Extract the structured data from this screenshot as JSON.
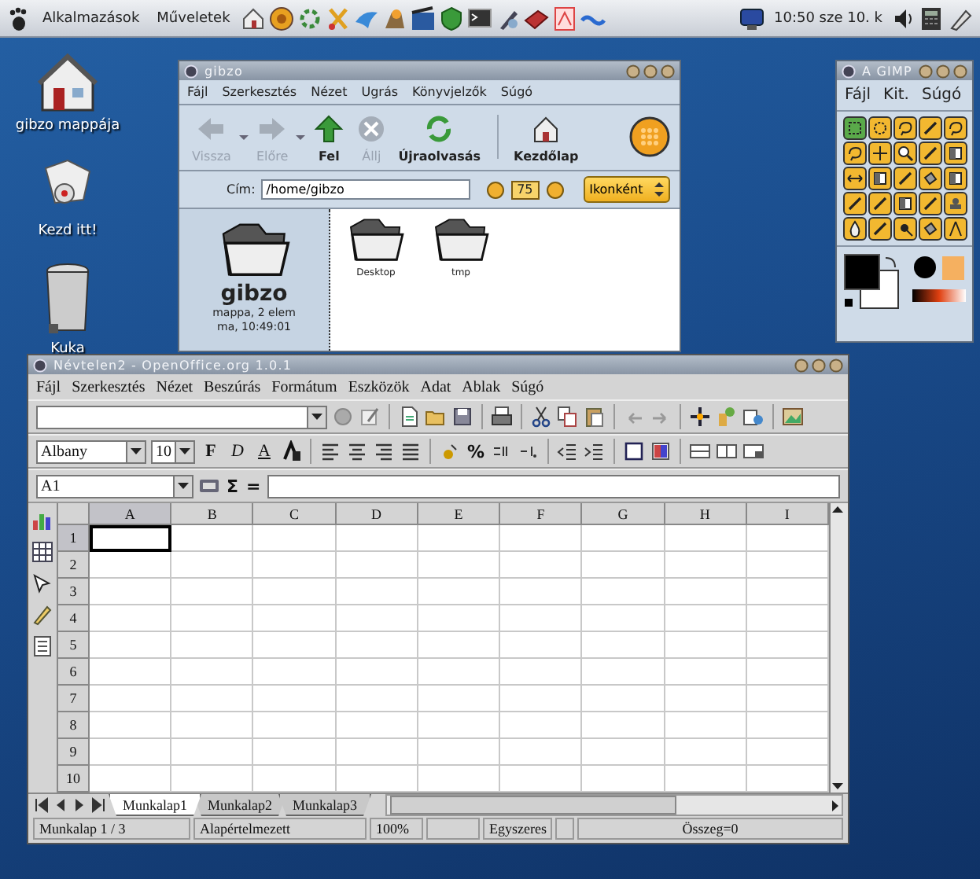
{
  "panel": {
    "menus": [
      "Alkalmazások",
      "Műveletek"
    ],
    "clock": "10:50 sze 10. k"
  },
  "desktop_icons": [
    {
      "label": "gibzo mappája",
      "kind": "home"
    },
    {
      "label": "Kezd itt!",
      "kind": "start"
    },
    {
      "label": "Kuka",
      "kind": "trash"
    }
  ],
  "file_manager": {
    "title": "gibzo",
    "menu": [
      "Fájl",
      "Szerkesztés",
      "Nézet",
      "Ugrás",
      "Könyvjelzők",
      "Súgó"
    ],
    "toolbar": [
      {
        "label": "Vissza",
        "kind": "back",
        "disabled": true
      },
      {
        "label": "Előre",
        "kind": "forward",
        "disabled": true
      },
      {
        "label": "Fel",
        "kind": "up",
        "disabled": false
      },
      {
        "label": "Állj",
        "kind": "stop",
        "disabled": true
      },
      {
        "label": "Újraolvasás",
        "kind": "reload",
        "disabled": false
      },
      {
        "label": "Kezdőlap",
        "kind": "home",
        "disabled": false
      }
    ],
    "address_label": "Cím:",
    "address": "/home/gibzo",
    "zoom": "75",
    "view_mode": "Ikonként",
    "side_pane": {
      "name": "gibzo",
      "info": "mappa, 2 elem",
      "modified": "ma, 10:49:01"
    },
    "items": [
      {
        "label": "Desktop"
      },
      {
        "label": "tmp"
      }
    ]
  },
  "gimp": {
    "title": "A GIMP",
    "menu": [
      "Fájl",
      "Kit.",
      "Súgó"
    ],
    "tools": [
      {
        "selected": true
      },
      {
        "selected": false
      },
      {
        "selected": false
      },
      {
        "selected": false
      },
      {
        "selected": false
      },
      {
        "selected": false
      },
      {
        "selected": false
      },
      {
        "selected": false
      },
      {
        "selected": false
      },
      {
        "selected": false
      },
      {
        "selected": false
      },
      {
        "selected": false
      },
      {
        "selected": false
      },
      {
        "selected": false
      },
      {
        "selected": false
      },
      {
        "selected": false
      },
      {
        "selected": false
      },
      {
        "selected": false
      },
      {
        "selected": false
      },
      {
        "selected": false
      },
      {
        "selected": false
      },
      {
        "selected": false
      },
      {
        "selected": false
      },
      {
        "selected": false
      },
      {
        "selected": false
      }
    ]
  },
  "spreadsheet": {
    "title": "Névtelen2 - OpenOffice.org 1.0.1",
    "menu": [
      "Fájl",
      "Szerkesztés",
      "Nézet",
      "Beszúrás",
      "Formátum",
      "Eszközök",
      "Adat",
      "Ablak",
      "Súgó"
    ],
    "font": "Albany",
    "font_size": "10",
    "format_buttons": [
      {
        "text": "F",
        "kind": "bold"
      },
      {
        "text": "D",
        "kind": "italic"
      },
      {
        "text": "A",
        "kind": "underline"
      }
    ],
    "percent_button": "%",
    "cell_ref": "A1",
    "formula_buttons": [
      "Σ",
      "="
    ],
    "columns": [
      {
        "label": "A",
        "selected": true
      },
      {
        "label": "B",
        "selected": false
      },
      {
        "label": "C",
        "selected": false
      },
      {
        "label": "D",
        "selected": false
      },
      {
        "label": "E",
        "selected": false
      },
      {
        "label": "F",
        "selected": false
      },
      {
        "label": "G",
        "selected": false
      },
      {
        "label": "H",
        "selected": false
      },
      {
        "label": "I",
        "selected": false
      }
    ],
    "rows": [
      {
        "label": "1",
        "selected": true
      },
      {
        "label": "2",
        "selected": false
      },
      {
        "label": "3",
        "selected": false
      },
      {
        "label": "4",
        "selected": false
      },
      {
        "label": "5",
        "selected": false
      },
      {
        "label": "6",
        "selected": false
      },
      {
        "label": "7",
        "selected": false
      },
      {
        "label": "8",
        "selected": false
      },
      {
        "label": "9",
        "selected": false
      },
      {
        "label": "10",
        "selected": false
      }
    ],
    "sheets": [
      {
        "label": "Munkalap1",
        "selected": true
      },
      {
        "label": "Munkalap2",
        "selected": false
      },
      {
        "label": "Munkalap3",
        "selected": false
      }
    ],
    "status_bar": [
      "Munkalap 1 / 3",
      "Alapértelmezett",
      "100%",
      "Egyszeres",
      "Összeg=0"
    ]
  }
}
